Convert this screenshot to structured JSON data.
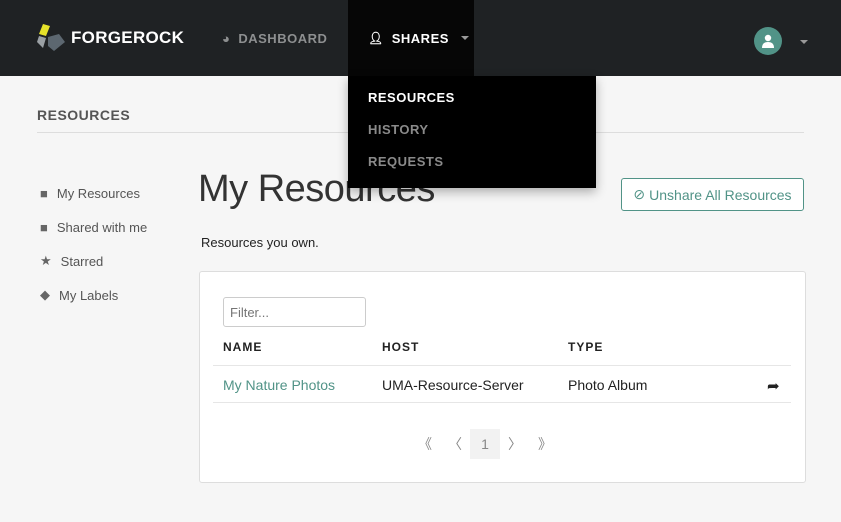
{
  "navbar": {
    "brand": "FORGEROCK",
    "items": [
      {
        "label": "DASHBOARD",
        "icon": "dashboard-icon"
      },
      {
        "label": "SHARES",
        "icon": "user-icon"
      }
    ]
  },
  "dropdown": {
    "items": [
      {
        "label": "RESOURCES",
        "active": true
      },
      {
        "label": "HISTORY"
      },
      {
        "label": "REQUESTS"
      }
    ]
  },
  "section_title": "RESOURCES",
  "sidebar": {
    "items": [
      {
        "label": "My Resources",
        "icon": "folder-icon"
      },
      {
        "label": "Shared with me",
        "icon": "folder-icon"
      },
      {
        "label": "Starred",
        "icon": "star-icon"
      },
      {
        "label": "My Labels",
        "icon": "tags-icon"
      }
    ]
  },
  "main": {
    "title": "My Resources",
    "subtitle": "Resources you own.",
    "unshare_label": "Unshare All Resources",
    "filter_placeholder": "Filter...",
    "columns": [
      "NAME",
      "HOST",
      "TYPE"
    ],
    "rows": [
      {
        "name": "My Nature Photos",
        "host": "UMA-Resource-Server",
        "type": "Photo Album"
      }
    ],
    "pager": {
      "first": "《",
      "prev": "〈",
      "current": "1",
      "next": "〉",
      "last": "》"
    }
  },
  "colors": {
    "accent": "#519387",
    "navbar": "#1f2224"
  }
}
